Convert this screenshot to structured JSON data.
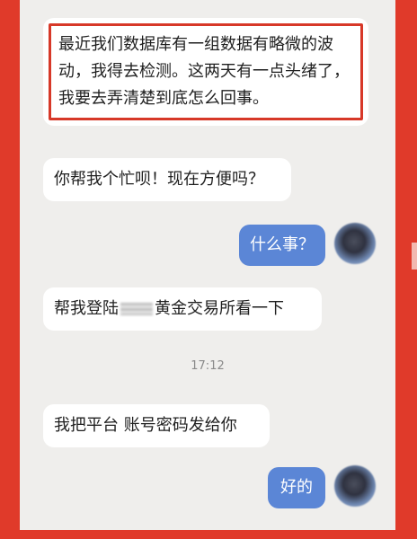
{
  "messages": [
    {
      "id": "m1",
      "side": "in",
      "text": "最近我们数据库有一组数据有略微的波动，我得去检测。这两天有一点头绪了，我要去弄清楚到底怎么回事。"
    },
    {
      "id": "m2",
      "side": "in",
      "text": "你帮我个忙呗！现在方便吗？"
    },
    {
      "id": "m3",
      "side": "out",
      "text": "什么事？"
    },
    {
      "id": "m4",
      "side": "in",
      "text_before": "帮我登陆",
      "text_after": "黄金交易所看一下"
    },
    {
      "id": "m5",
      "side": "in",
      "text": "我把平台 账号密码发给你"
    },
    {
      "id": "m6",
      "side": "out",
      "text": "好的"
    }
  ],
  "timestamp": "17:12",
  "colors": {
    "background_frame": "#e03a2a",
    "chat_background": "#efeeec",
    "incoming_bubble": "#ffffff",
    "outgoing_bubble": "#5b86d6",
    "highlight_border": "#d73828"
  },
  "icons": [
    "user-avatar-icon"
  ]
}
